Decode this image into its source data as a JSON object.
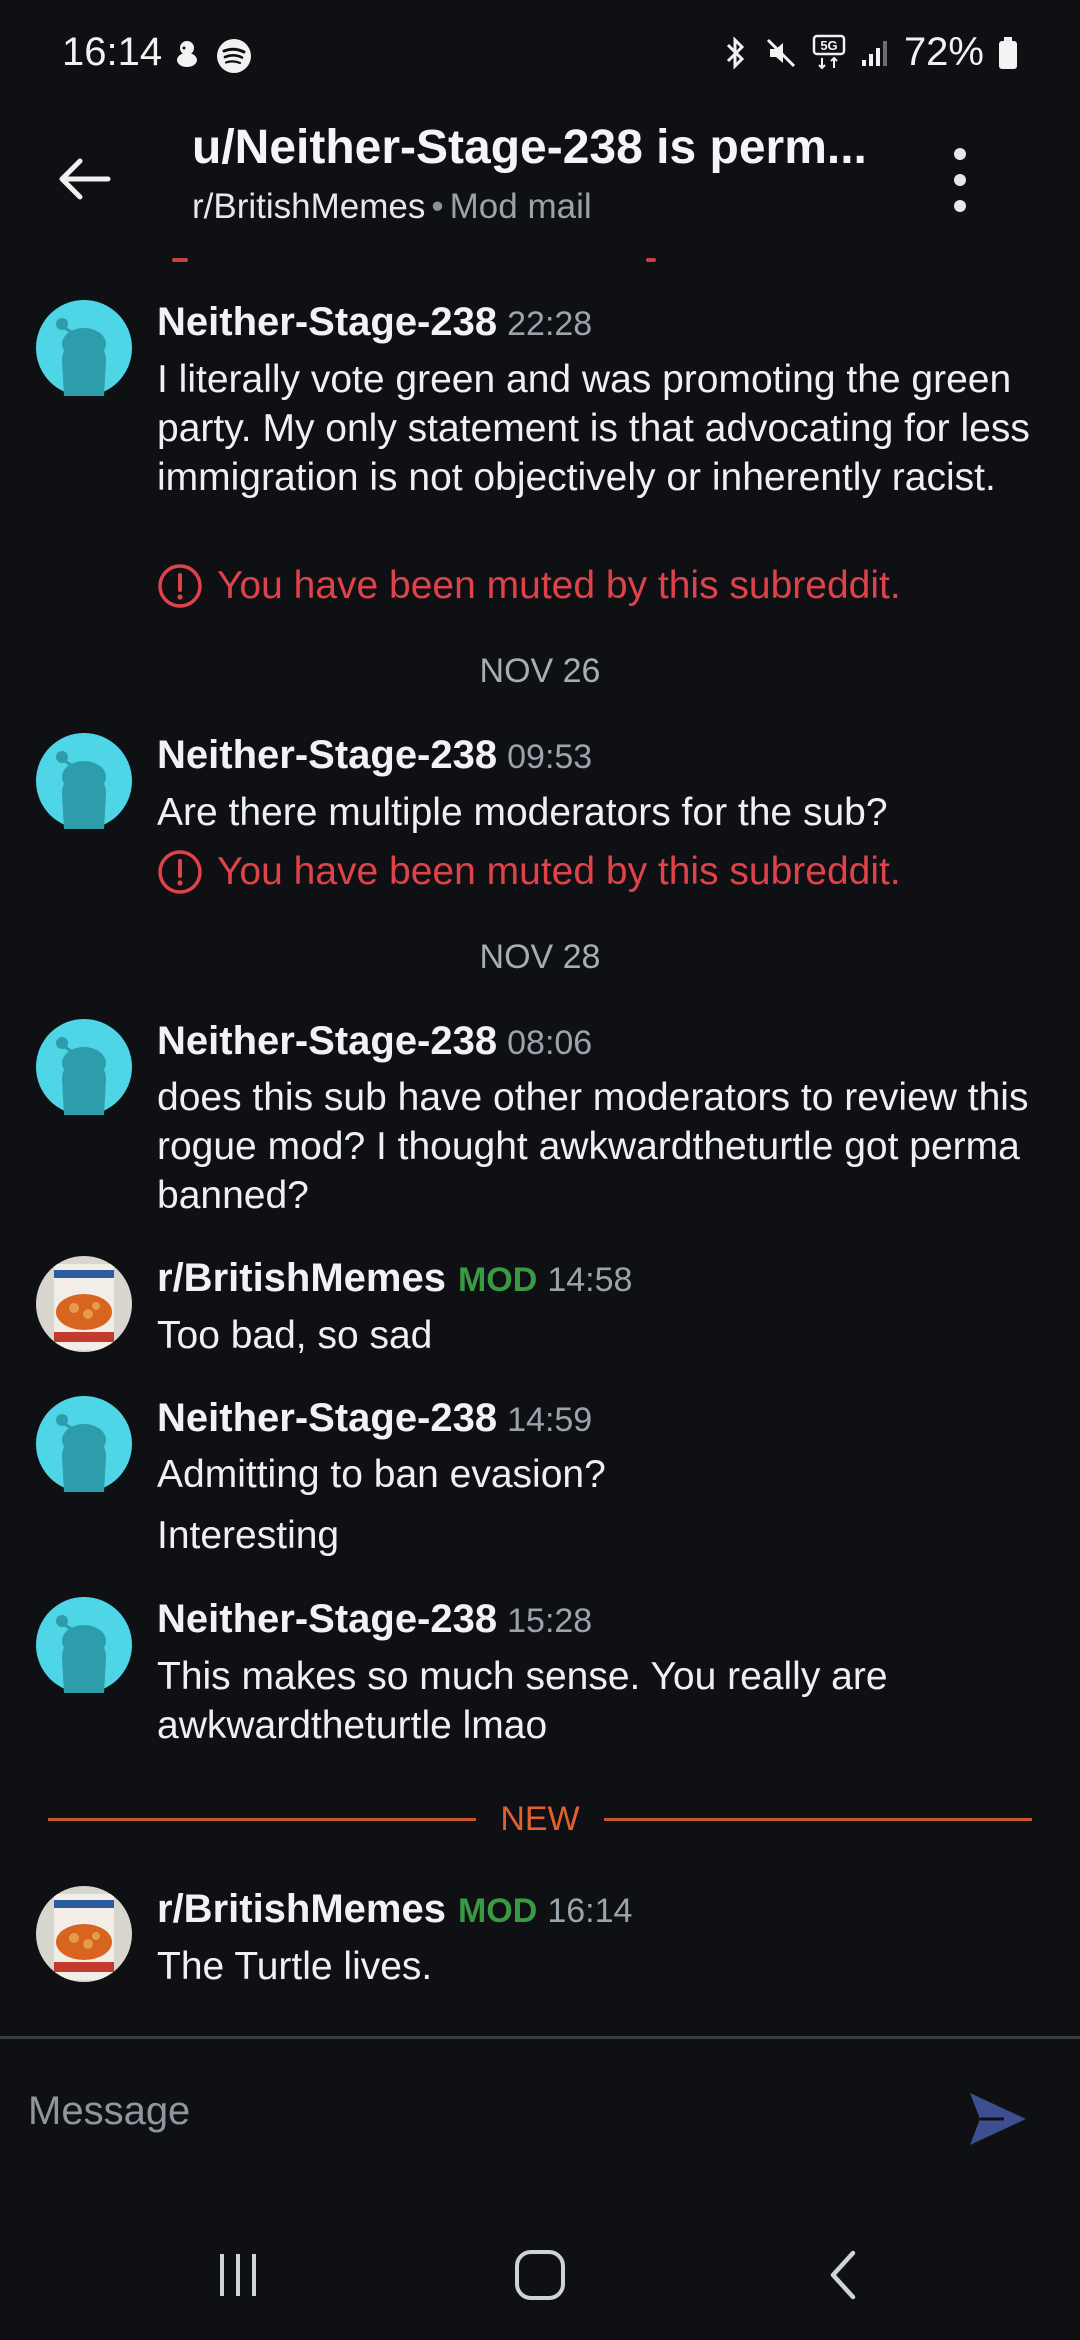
{
  "status_bar": {
    "time": "16:14",
    "left_icons": [
      "bitmoji-icon",
      "spotify-icon"
    ],
    "right_icons": [
      "bluetooth-icon",
      "mute-icon",
      "5g-icon",
      "signal-icon"
    ],
    "battery_text": "72%"
  },
  "header": {
    "title": "u/Neither-Stage-238 is perm...",
    "subreddit": "r/BritishMemes",
    "separator": "•",
    "section": "Mod mail"
  },
  "messages": [
    {
      "author": "Neither-Stage-238",
      "time": "22:28",
      "body": "I literally vote green and was promoting the green party. My only statement is that advocating for less immigration is not objectively or inherently racist.",
      "muted": "You have been muted by this subreddit."
    },
    {
      "date": "NOV 26"
    },
    {
      "author": "Neither-Stage-238",
      "time": "09:53",
      "body": "Are there multiple moderators for the sub?",
      "muted": "You have been muted by this subreddit."
    },
    {
      "date": "NOV 28"
    },
    {
      "author": "Neither-Stage-238",
      "time": "08:06",
      "body": "does this sub have other moderators to review this rogue mod? I thought awkwardtheturtle got perma banned?"
    },
    {
      "author": "r/BritishMemes",
      "badge": "MOD",
      "time": "14:58",
      "body": "Too bad, so sad"
    },
    {
      "author": "Neither-Stage-238",
      "time": "14:59",
      "body": "Admitting to ban evasion?",
      "body2": "Interesting"
    },
    {
      "author": "Neither-Stage-238",
      "time": "15:28",
      "body": "This makes so much sense. You really are awkwardtheturtle lmao"
    },
    {
      "new_label": "NEW"
    },
    {
      "author": "r/BritishMemes",
      "badge": "MOD",
      "time": "16:14",
      "body": "The Turtle lives."
    }
  ],
  "composer": {
    "placeholder": "Message"
  },
  "colors": {
    "background": "#0f1013",
    "muted_red": "#e0424a",
    "mod_green": "#3a9a44",
    "new_orange": "#e0612f",
    "snoo_teal": "#4fd6e6"
  }
}
